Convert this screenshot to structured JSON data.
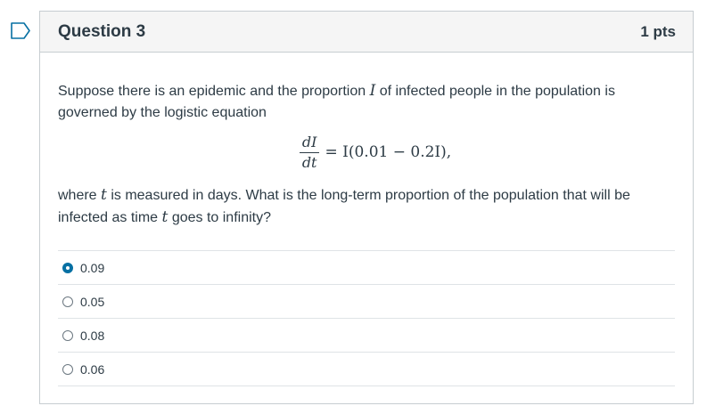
{
  "question": {
    "title": "Question 3",
    "points": "1 pts",
    "text_before": "Suppose there is an epidemic and the proportion",
    "var_I": "I",
    "text_middle": "of infected people in the population is governed by the logistic equation",
    "equation": {
      "numerator": "dI",
      "denominator": "dt",
      "rhs": "= I(0.01 − 0.2I),"
    },
    "text_after_1": "where",
    "var_t": "t",
    "text_after_2": "is measured in days.  What is the long-term proportion of the population that will be infected as time",
    "text_after_3": "goes to infinity?"
  },
  "answers": [
    {
      "label": "0.09",
      "selected": true
    },
    {
      "label": "0.05",
      "selected": false
    },
    {
      "label": "0.08",
      "selected": false
    },
    {
      "label": "0.06",
      "selected": false
    }
  ],
  "colors": {
    "accent": "#0770a3",
    "text": "#2d3b45",
    "header_bg": "#f5f5f5"
  },
  "icons": {
    "flag": "flag-outline-icon"
  }
}
